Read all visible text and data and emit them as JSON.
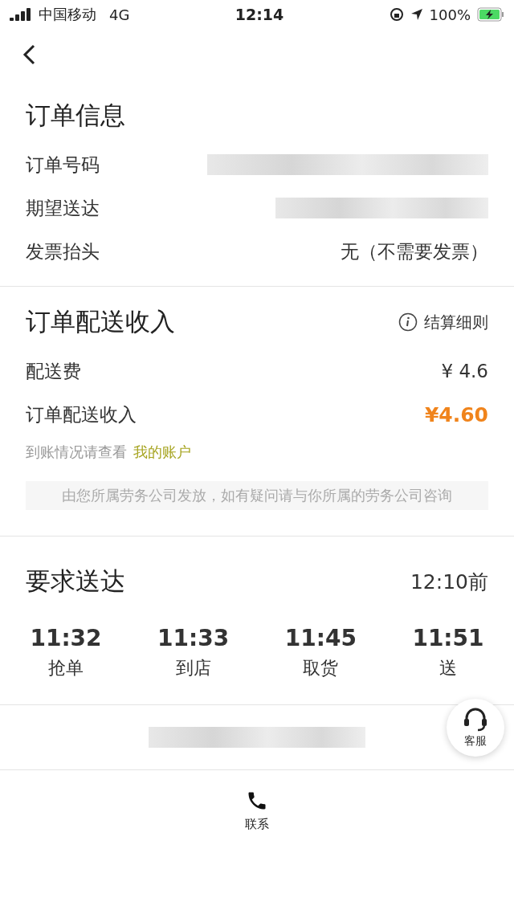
{
  "status_bar": {
    "carrier": "中国移动",
    "network": "4G",
    "time": "12:14",
    "battery": "100%"
  },
  "order_info": {
    "title": "订单信息",
    "rows": [
      {
        "label": "订单号码",
        "kind": "redacted"
      },
      {
        "label": "期望送达",
        "kind": "redacted"
      },
      {
        "label": "发票抬头",
        "kind": "text",
        "value": "无（不需要发票）"
      }
    ]
  },
  "income": {
    "title": "订单配送收入",
    "rules_link": "结算细则",
    "rows": [
      {
        "label": "配送费",
        "value": "¥ 4.6",
        "kind": "plain"
      },
      {
        "label": "订单配送收入",
        "value": "¥4.60",
        "kind": "highlight"
      }
    ],
    "account_hint": "到账情况请查看",
    "account_link": "我的账户",
    "notice": "由您所属劳务公司发放，如有疑问请与你所属的劳务公司咨询"
  },
  "delivery": {
    "title": "要求送达",
    "deadline": "12:10前",
    "steps": [
      {
        "time": "11:32",
        "label": "抢单"
      },
      {
        "time": "11:33",
        "label": "到店"
      },
      {
        "time": "11:45",
        "label": "取货"
      },
      {
        "time": "11:51",
        "label": "送"
      }
    ]
  },
  "support_button": "客服",
  "contact_button": "联系"
}
